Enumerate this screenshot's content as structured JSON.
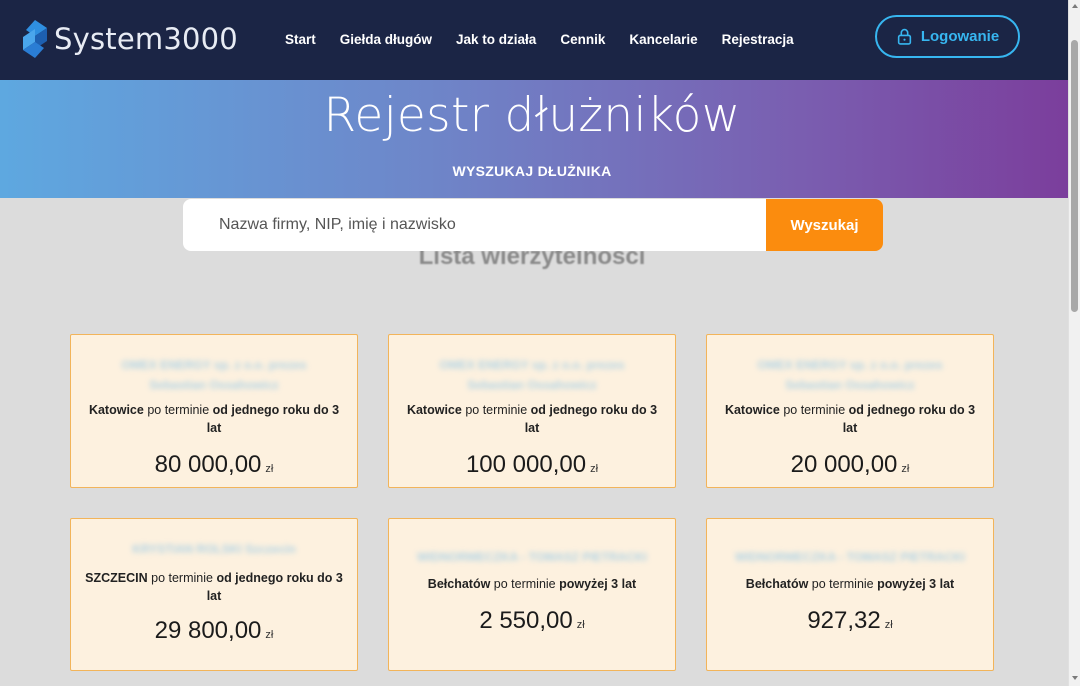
{
  "header": {
    "logo_text": "System3000",
    "nav": [
      "Start",
      "Giełda długów",
      "Jak to działa",
      "Cennik",
      "Kancelarie",
      "Rejestracja"
    ],
    "login_label": "Logowanie"
  },
  "hero": {
    "title": "Rejestr dłużników",
    "subtitle": "WYSZUKAJ DŁUŻNIKA"
  },
  "search": {
    "placeholder": "Nazwa firmy, NIP, imię i nazwisko",
    "value": "",
    "button_label": "Wyszukaj"
  },
  "section_title": "Lista wierzytelności",
  "cards": [
    {
      "name": "OMEX ENERGY sp. z o.o. prezes Sebastian Ossahowicz",
      "city": "Katowice",
      "mid": " po terminie ",
      "period": "od jednego roku do 3 lat",
      "amount": "80 000,00",
      "currency": "zł"
    },
    {
      "name": "OMEX ENERGY sp. z o.o. prezes Sebastian Ossahowicz",
      "city": "Katowice",
      "mid": " po terminie ",
      "period": "od jednego roku do 3 lat",
      "amount": "100 000,00",
      "currency": "zł"
    },
    {
      "name": "OMEX ENERGY sp. z o.o. prezes Sebastian Ossahowicz",
      "city": "Katowice",
      "mid": " po terminie ",
      "period": "od jednego roku do 3 lat",
      "amount": "20 000,00",
      "currency": "zł"
    },
    {
      "name": "KRYSTIAN ROLSKI Szczecin",
      "city": "SZCZECIN",
      "mid": " po terminie ",
      "period": "od jednego roku do 3 lat",
      "amount": "29 800,00",
      "currency": "zł"
    },
    {
      "name": "WIDNORMECZKA - TOMASZ PIETRACKI",
      "city": "Bełchatów",
      "mid": " po terminie ",
      "period": "powyżej 3 lat",
      "amount": "2 550,00",
      "currency": "zł"
    },
    {
      "name": "WIDNORMECZKA - TOMASZ PIETRACKI",
      "city": "Bełchatów",
      "mid": " po terminie ",
      "period": "powyżej 3 lat",
      "amount": "927,32",
      "currency": "zł"
    }
  ],
  "colors": {
    "navbar": "#1b2545",
    "accent": "#37b6f0",
    "search_button": "#fb8c0e",
    "card_bg": "#fdf1df",
    "card_border": "#f2b45a"
  },
  "icons": {
    "logo": "system3000-logo-icon",
    "login": "lock-icon"
  }
}
